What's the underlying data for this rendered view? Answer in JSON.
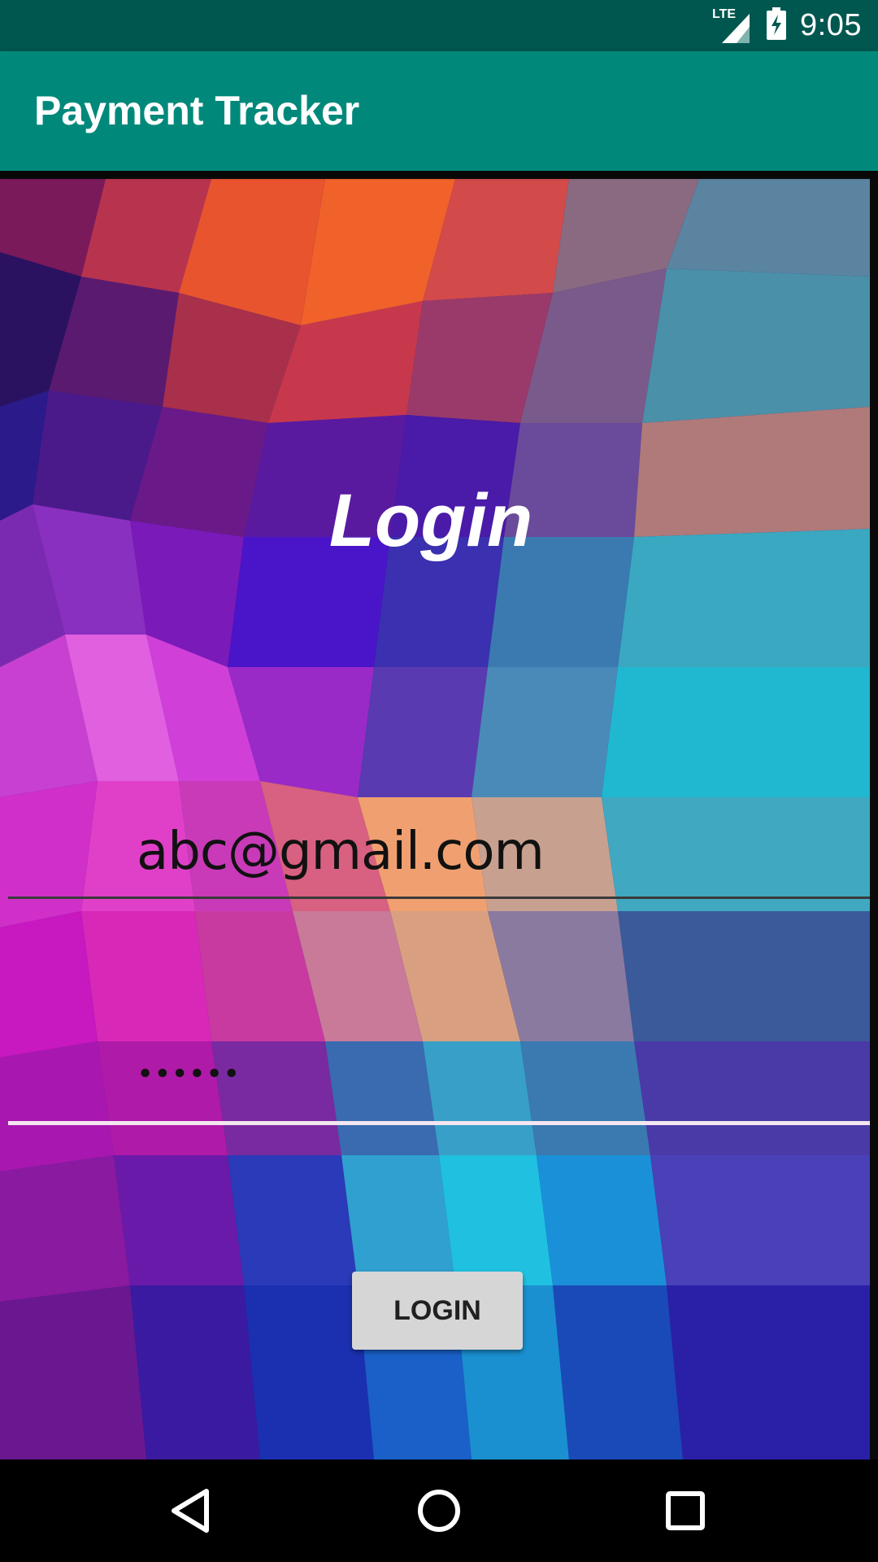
{
  "status_bar": {
    "network": "LTE",
    "time": "9:05",
    "icons": [
      "signal-icon",
      "battery-charging-icon"
    ]
  },
  "app_bar": {
    "title": "Payment Tracker"
  },
  "login_form": {
    "heading": "Login",
    "email_value": "abc@gmail.com",
    "password_value": "••••••",
    "login_button_label": "LOGIN"
  },
  "nav_bar": {
    "icons": [
      "back-icon",
      "home-icon",
      "recents-icon"
    ]
  },
  "colors": {
    "status_bar": "#00574f",
    "app_bar": "#00897b",
    "button": "#d6d6d6"
  }
}
